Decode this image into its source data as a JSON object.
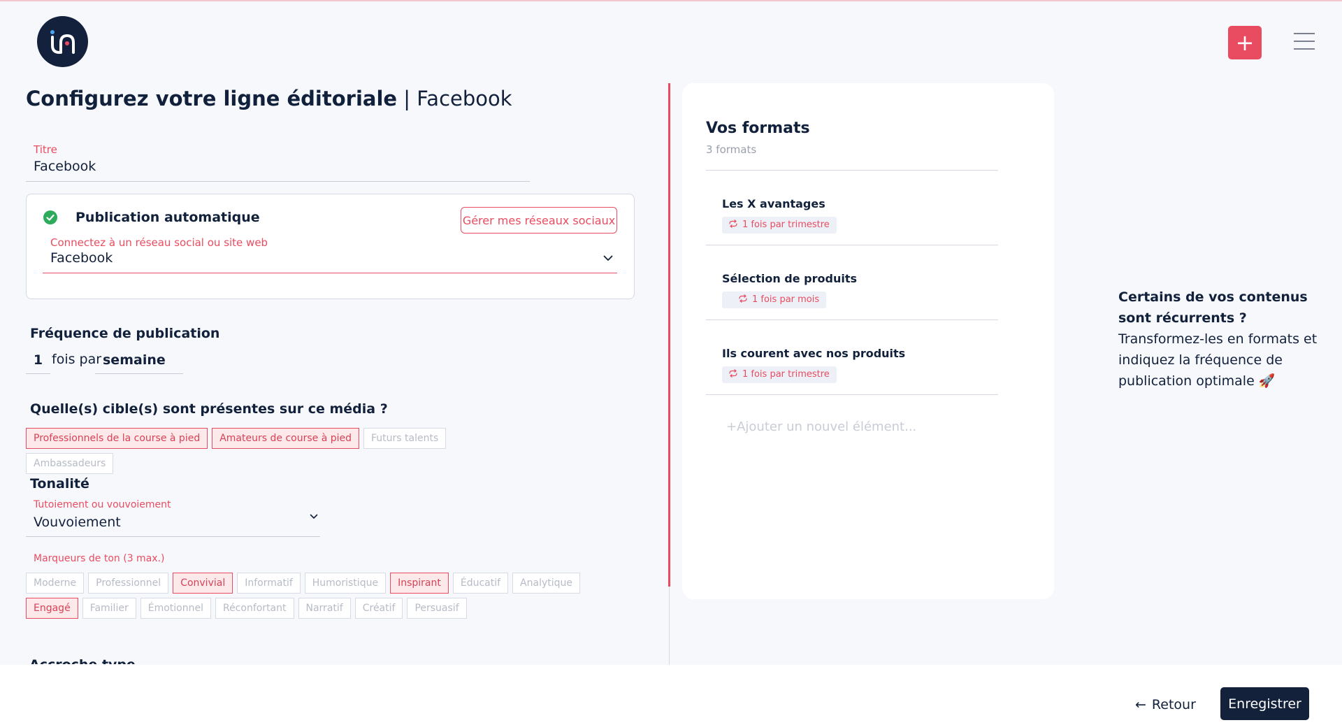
{
  "header": {
    "add_label": "+"
  },
  "page": {
    "title_bold": "Configurez votre ligne éditoriale",
    "title_sub": " | Facebook"
  },
  "title_field": {
    "label": "Titre",
    "value": "Facebook"
  },
  "auto_publish": {
    "title": "Publication automatique",
    "manage_label": "Gérer mes réseaux sociaux",
    "select_label": "Connectez à un réseau social ou site web",
    "select_value": "Facebook"
  },
  "frequency": {
    "title": "Fréquence de publication",
    "count": "1",
    "text": "fois par",
    "unit": "semaine"
  },
  "targets": {
    "title": "Quelle(s) cible(s) sont présentes sur ce média ?",
    "items": [
      {
        "label": "Professionnels de la course à pied",
        "selected": true
      },
      {
        "label": "Amateurs de course à pied",
        "selected": true
      },
      {
        "label": "Futurs talents",
        "selected": false
      },
      {
        "label": "Ambassadeurs",
        "selected": false
      }
    ]
  },
  "tone": {
    "title": "Tonalité",
    "select_label": "Tutoiement ou vouvoiement",
    "select_value": "Vouvoiement",
    "markers_label": "Marqueurs de ton (3 max.)",
    "markers": [
      {
        "label": "Moderne",
        "selected": false
      },
      {
        "label": "Professionnel",
        "selected": false
      },
      {
        "label": "Convivial",
        "selected": true
      },
      {
        "label": "Informatif",
        "selected": false
      },
      {
        "label": "Humoristique",
        "selected": false
      },
      {
        "label": "Inspirant",
        "selected": true
      },
      {
        "label": "Éducatif",
        "selected": false
      },
      {
        "label": "Analytique",
        "selected": false
      },
      {
        "label": "Engagé",
        "selected": true
      },
      {
        "label": "Familier",
        "selected": false
      },
      {
        "label": "Émotionnel",
        "selected": false
      },
      {
        "label": "Réconfortant",
        "selected": false
      },
      {
        "label": "Narratif",
        "selected": false
      },
      {
        "label": "Créatif",
        "selected": false
      },
      {
        "label": "Persuasif",
        "selected": false
      }
    ]
  },
  "next_section": {
    "partial_title": "Accroche type"
  },
  "formats": {
    "title": "Vos formats",
    "count": "3 formats",
    "items": [
      {
        "name": "Les X avantages",
        "frequency": "1 fois par trimestre"
      },
      {
        "name": "Sélection de produits",
        "frequency": "1 fois par mois"
      },
      {
        "name": "Ils courent avec nos produits",
        "frequency": "1 fois par trimestre"
      }
    ],
    "add_placeholder": "+Ajouter un nouvel élément..."
  },
  "info": {
    "bold": "Certains de vos contenus sont récurrents ?",
    "text": " Transformez-les en formats et indiquez la fréquence de publication optimale 🚀"
  },
  "footer": {
    "back_label": "Retour",
    "save_label": "Enregistrer"
  },
  "colors": {
    "accent": "#e94c60",
    "navy": "#13213b",
    "success": "#2eaa5c",
    "background": "#f7f8fc"
  }
}
